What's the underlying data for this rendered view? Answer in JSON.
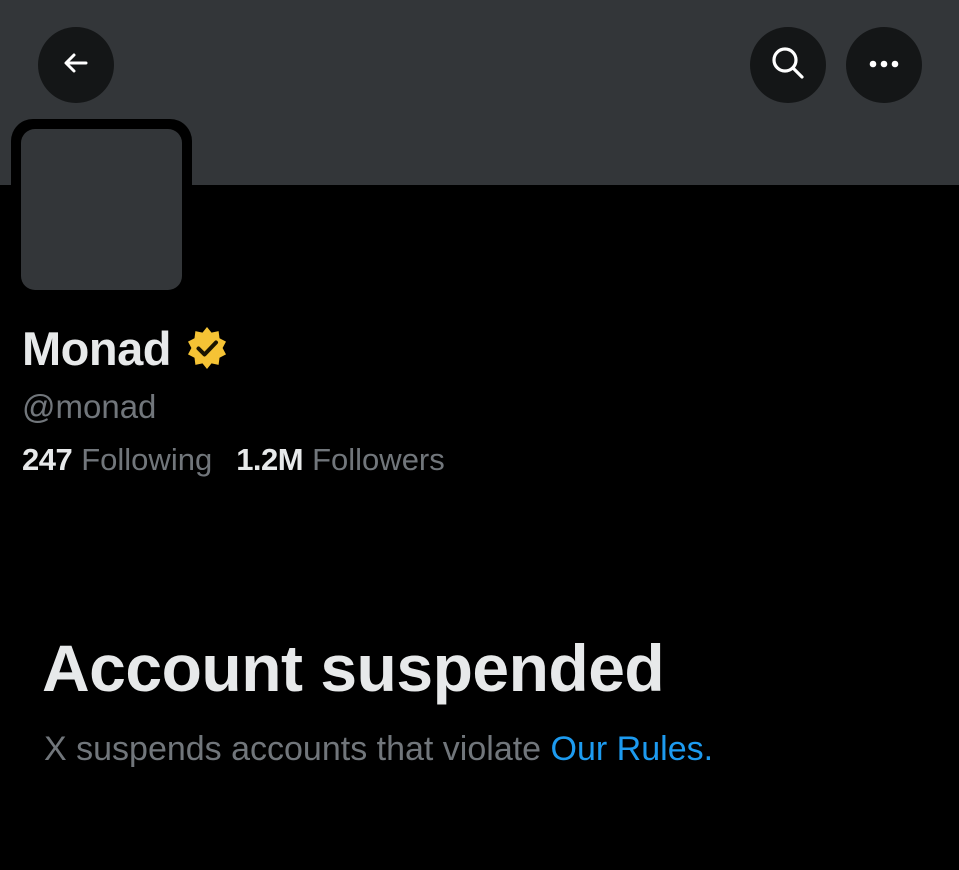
{
  "header": {
    "back_icon": "arrow-left-icon",
    "search_icon": "search-icon",
    "more_icon": "more-horizontal-icon"
  },
  "profile": {
    "display_name": "Monad",
    "verified_badge": "verified-gold-icon",
    "badge_color": "#f5c335",
    "handle": "@monad",
    "following_count": "247",
    "following_label": "Following",
    "followers_count": "1.2M",
    "followers_label": "Followers"
  },
  "suspension": {
    "title": "Account suspended",
    "message": "X suspends accounts that violate",
    "link_text": "Our Rules",
    "period": "."
  },
  "colors": {
    "background": "#000000",
    "banner": "#333639",
    "primary_text": "#e7e9ea",
    "secondary_text": "#71767b",
    "link": "#1d9bf0"
  }
}
